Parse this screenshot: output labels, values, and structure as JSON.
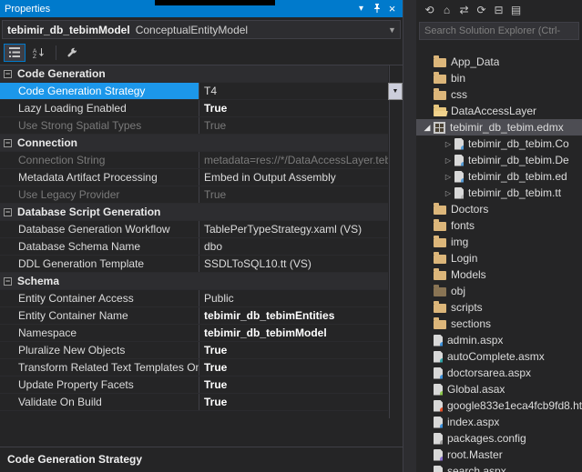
{
  "colors": {
    "accent": "#007ACC",
    "selection_blue": "#1C97EA",
    "folder_yellow": "#DCB67A",
    "panel_background": "#252526"
  },
  "properties_panel": {
    "title": "Properties",
    "titlebar_icons": [
      {
        "name": "window-position-icon"
      },
      {
        "name": "pin-icon"
      },
      {
        "name": "close-icon"
      }
    ],
    "object_name": "tebimir_db_tebimModel",
    "object_type": "ConceptualEntityModel",
    "toolbar_icons": [
      {
        "name": "categorized-view-icon"
      },
      {
        "name": "alphabetical-view-icon"
      },
      {
        "name": "property-pages-icon"
      }
    ],
    "rows": [
      {
        "type": "category",
        "label": "Code Generation"
      },
      {
        "type": "prop",
        "name": "Code Generation Strategy",
        "value": "T4",
        "selected": true,
        "dropdown": true
      },
      {
        "type": "prop",
        "name": "Lazy Loading Enabled",
        "value": "True",
        "bold": true
      },
      {
        "type": "prop",
        "name": "Use Strong Spatial Types",
        "value": "True",
        "disabled": true
      },
      {
        "type": "category",
        "label": "Connection"
      },
      {
        "type": "prop",
        "name": "Connection String",
        "value": "metadata=res://*/DataAccessLayer.tebim",
        "disabled": true
      },
      {
        "type": "prop",
        "name": "Metadata Artifact Processing",
        "value": "Embed in Output Assembly"
      },
      {
        "type": "prop",
        "name": "Use Legacy Provider",
        "value": "True",
        "disabled": true
      },
      {
        "type": "category",
        "label": "Database Script Generation"
      },
      {
        "type": "prop",
        "name": "Database Generation Workflow",
        "value": "TablePerTypeStrategy.xaml (VS)"
      },
      {
        "type": "prop",
        "name": "Database Schema Name",
        "value": "dbo"
      },
      {
        "type": "prop",
        "name": "DDL Generation Template",
        "value": "SSDLToSQL10.tt (VS)"
      },
      {
        "type": "category",
        "label": "Schema"
      },
      {
        "type": "prop",
        "name": "Entity Container Access",
        "value": "Public"
      },
      {
        "type": "prop",
        "name": "Entity Container Name",
        "value": "tebimir_db_tebimEntities",
        "bold": true
      },
      {
        "type": "prop",
        "name": "Namespace",
        "value": "tebimir_db_tebimModel",
        "bold": true
      },
      {
        "type": "prop",
        "name": "Pluralize New Objects",
        "value": "True",
        "bold": true
      },
      {
        "type": "prop",
        "name": "Transform Related Text Templates On",
        "value": "True",
        "bold": true
      },
      {
        "type": "prop",
        "name": "Update Property Facets",
        "value": "True",
        "bold": true
      },
      {
        "type": "prop",
        "name": "Validate On Build",
        "value": "True",
        "bold": true
      }
    ],
    "description_title": "Code Generation Strategy"
  },
  "solution_explorer": {
    "toolbar_icons": [
      {
        "name": "back-icon",
        "glyph": "⟲"
      },
      {
        "name": "home-icon",
        "glyph": "⌂"
      },
      {
        "name": "switch-views-icon",
        "glyph": "⇄"
      },
      {
        "name": "sync-with-active-document-icon",
        "glyph": "⟳"
      },
      {
        "name": "collapse-all-icon",
        "glyph": "⊟"
      },
      {
        "name": "show-all-files-icon",
        "glyph": "▤"
      }
    ],
    "search_placeholder": "Search Solution Explorer (Ctrl-",
    "items": [
      {
        "label": "App_Data",
        "icon": "folder",
        "indent": 1,
        "arrow": "none"
      },
      {
        "label": "bin",
        "icon": "folder",
        "indent": 1,
        "arrow": "none"
      },
      {
        "label": "css",
        "icon": "folder",
        "indent": 1,
        "arrow": "none"
      },
      {
        "label": "DataAccessLayer",
        "icon": "folder-open",
        "indent": 1,
        "arrow": "none"
      },
      {
        "label": "tebimir_db_tebim.edmx",
        "icon": "edmx",
        "indent": 1,
        "arrow": "expanded",
        "selected": true
      },
      {
        "label": "tebimir_db_tebim.Co",
        "icon": "code",
        "indent": 2,
        "arrow": "collapsed"
      },
      {
        "label": "tebimir_db_tebim.De",
        "icon": "code",
        "indent": 2,
        "arrow": "collapsed"
      },
      {
        "label": "tebimir_db_tebim.ed",
        "icon": "code",
        "indent": 2,
        "arrow": "collapsed"
      },
      {
        "label": "tebimir_db_tebim.tt",
        "icon": "tt",
        "indent": 2,
        "arrow": "collapsed"
      },
      {
        "label": "Doctors",
        "icon": "folder",
        "indent": 1,
        "arrow": "none"
      },
      {
        "label": "fonts",
        "icon": "folder",
        "indent": 1,
        "arrow": "none"
      },
      {
        "label": "img",
        "icon": "folder",
        "indent": 1,
        "arrow": "none"
      },
      {
        "label": "Login",
        "icon": "folder",
        "indent": 1,
        "arrow": "none"
      },
      {
        "label": "Models",
        "icon": "folder",
        "indent": 1,
        "arrow": "none"
      },
      {
        "label": "obj",
        "icon": "folder-dim",
        "indent": 1,
        "arrow": "none"
      },
      {
        "label": "scripts",
        "icon": "folder",
        "indent": 1,
        "arrow": "none"
      },
      {
        "label": "sections",
        "icon": "folder",
        "indent": 1,
        "arrow": "none"
      },
      {
        "label": "admin.aspx",
        "icon": "webform",
        "indent": 1,
        "arrow": "none"
      },
      {
        "label": "autoComplete.asmx",
        "icon": "asmx",
        "indent": 1,
        "arrow": "none"
      },
      {
        "label": "doctorsarea.aspx",
        "icon": "webform",
        "indent": 1,
        "arrow": "none"
      },
      {
        "label": "Global.asax",
        "icon": "asax",
        "indent": 1,
        "arrow": "none"
      },
      {
        "label": "google833e1eca4fcb9fd8.ht",
        "icon": "html",
        "indent": 1,
        "arrow": "none"
      },
      {
        "label": "index.aspx",
        "icon": "webform",
        "indent": 1,
        "arrow": "none"
      },
      {
        "label": "packages.config",
        "icon": "config",
        "indent": 1,
        "arrow": "none"
      },
      {
        "label": "root.Master",
        "icon": "master",
        "indent": 1,
        "arrow": "none"
      },
      {
        "label": "search.aspx",
        "icon": "webform",
        "indent": 1,
        "arrow": "none"
      }
    ]
  }
}
